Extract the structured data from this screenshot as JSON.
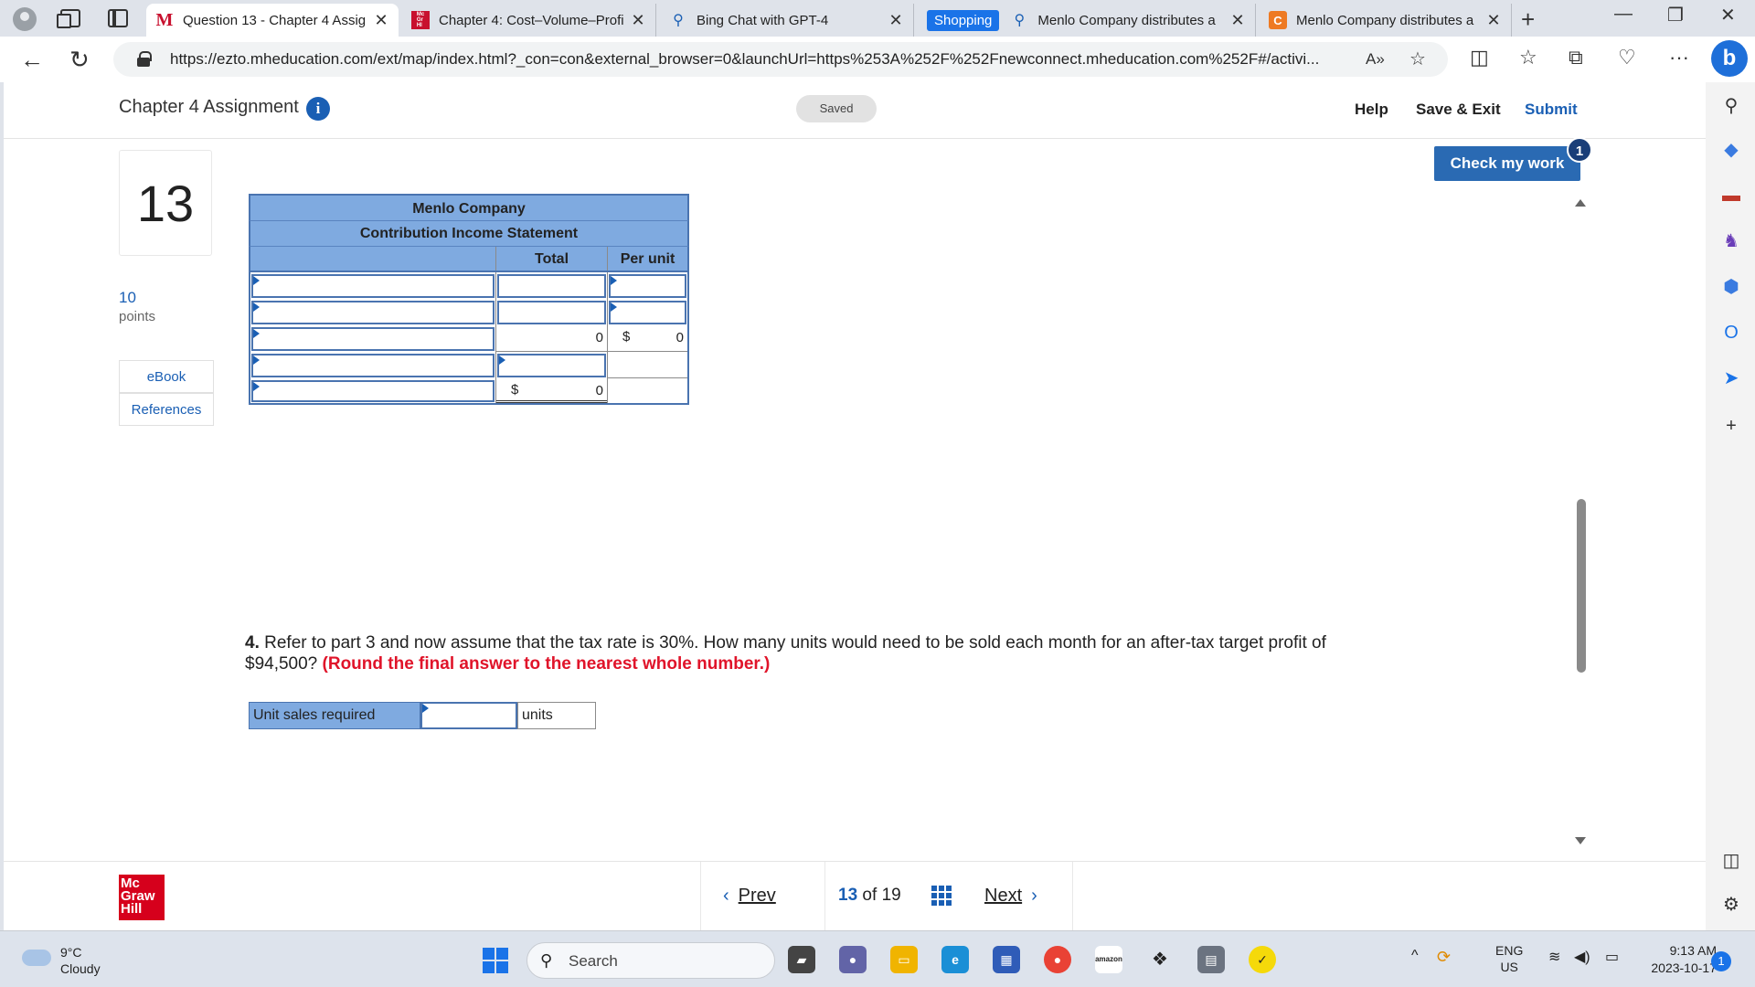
{
  "browser": {
    "tabs": [
      {
        "title": "Question 13 - Chapter 4 Assig",
        "favicon": "mcgraw-m-icon",
        "active": true
      },
      {
        "title": "Chapter 4: Cost–Volume–Profi",
        "favicon": "mcgraw-hill-icon",
        "active": false
      },
      {
        "title": "Bing Chat with GPT-4",
        "favicon": "search-icon",
        "active": false
      },
      {
        "title": "Menlo Company distributes a",
        "favicon": "search-icon",
        "active": false,
        "group": "Shopping"
      },
      {
        "title": "Menlo Company distributes a",
        "favicon": "chegg-c-icon",
        "active": false
      }
    ],
    "url": "https://ezto.mheducation.com/ext/map/index.html?_con=con&external_browser=0&launchUrl=https%253A%252F%252Fnewconnect.mheducation.com%252F#/activi..."
  },
  "header": {
    "assignment_title": "Chapter 4 Assignment",
    "saved_label": "Saved",
    "help_label": "Help",
    "save_exit_label": "Save & Exit",
    "submit_label": "Submit"
  },
  "question": {
    "number": "13",
    "points_value": "10",
    "points_label": "points",
    "ebook_label": "eBook",
    "references_label": "References",
    "check_work_label": "Check my work",
    "check_work_badge": "1"
  },
  "statement": {
    "company": "Menlo Company",
    "title": "Contribution Income Statement",
    "col_total": "Total",
    "col_per_unit": "Per unit",
    "row3_total": "0",
    "row3_per_unit_currency": "$",
    "row3_per_unit": "0",
    "row5_total_currency": "$",
    "row5_total": "0"
  },
  "part4": {
    "number": "4.",
    "text": " Refer to part 3 and now assume that the tax rate is 30%. How many units would need to be sold each month for an after-tax target profit of $94,500? ",
    "note": "(Round the final answer to the nearest whole number.)",
    "unit_sales_label": "Unit sales required",
    "unit_sales_value": "",
    "units_label": "units"
  },
  "footer": {
    "brand": "Mc Graw Hill",
    "prev_label": "Prev",
    "current_page": "13",
    "of_label": "of",
    "total_pages": "19",
    "next_label": "Next"
  },
  "taskbar": {
    "temperature": "9°C",
    "weather": "Cloudy",
    "search_label": "Search",
    "lang": "ENG",
    "region": "US",
    "time": "9:13 AM",
    "date": "2023-10-17",
    "notification_count": "1"
  }
}
